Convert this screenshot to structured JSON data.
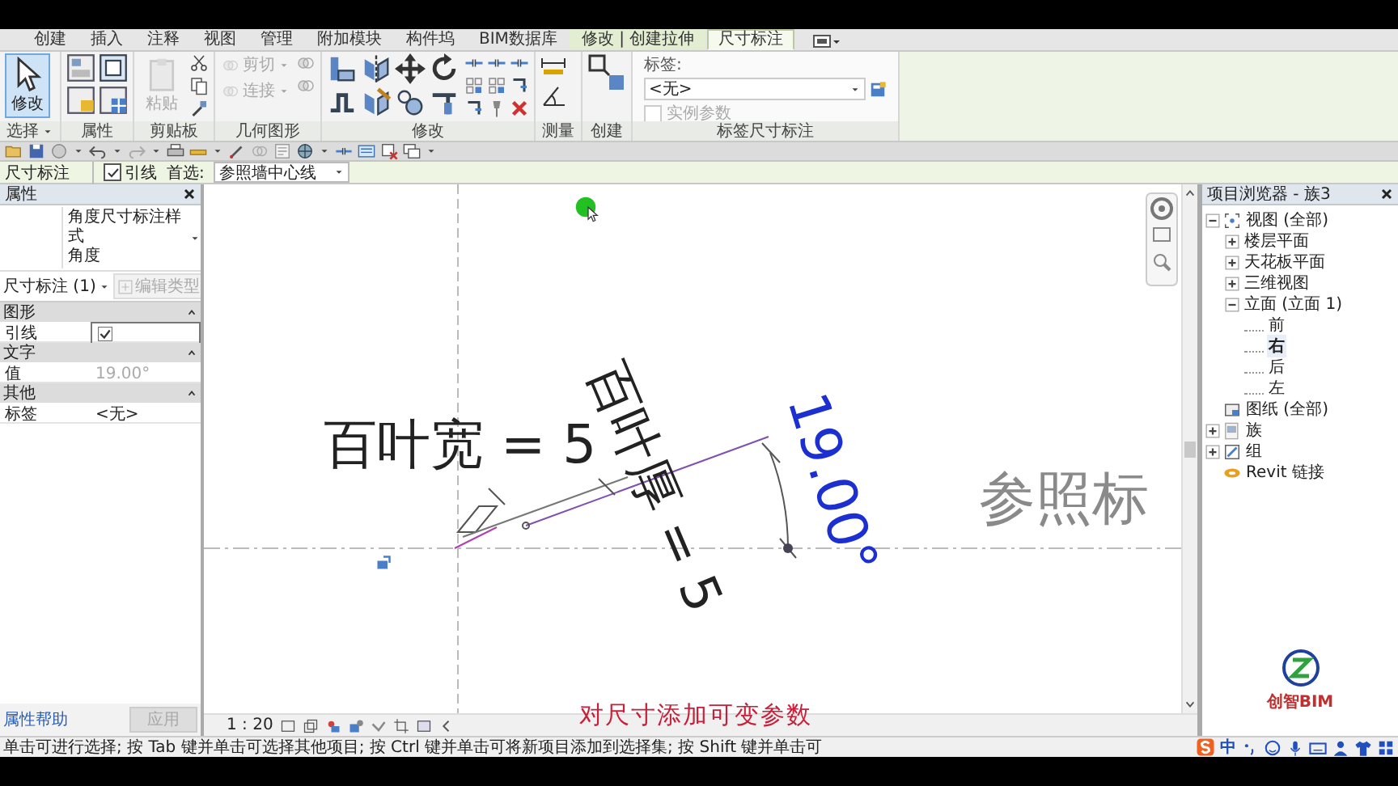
{
  "ribbon_tabs": [
    {
      "label": "创建",
      "kind": "normal",
      "selected": false
    },
    {
      "label": "插入",
      "kind": "normal",
      "selected": false
    },
    {
      "label": "注释",
      "kind": "normal",
      "selected": false
    },
    {
      "label": "视图",
      "kind": "normal",
      "selected": false
    },
    {
      "label": "管理",
      "kind": "normal",
      "selected": false
    },
    {
      "label": "附加模块",
      "kind": "normal",
      "selected": false
    },
    {
      "label": "构件坞",
      "kind": "normal",
      "selected": false
    },
    {
      "label": "BIM数据库",
      "kind": "normal",
      "selected": false
    },
    {
      "label": "修改 | 创建拉伸",
      "kind": "context",
      "selected": false
    },
    {
      "label": "尺寸标注",
      "kind": "context",
      "selected": true
    }
  ],
  "ribbon_panels": [
    {
      "title": "选择",
      "dropdown": true,
      "tools": [
        {
          "label": "修改",
          "kind": "big",
          "selected": true,
          "disabled": false
        }
      ]
    },
    {
      "title": "属性"
    },
    {
      "title": "剪贴板",
      "tools": [
        {
          "label": "粘贴",
          "kind": "big",
          "selected": false,
          "disabled": true
        }
      ]
    },
    {
      "title": "几何图形",
      "tools": [
        {
          "label": "剪切",
          "kind": "small",
          "selected": false,
          "disabled": true
        },
        {
          "label": "连接",
          "kind": "small",
          "selected": false,
          "disabled": true
        }
      ]
    },
    {
      "title": "修改"
    },
    {
      "title": "测量"
    },
    {
      "title": "创建"
    },
    {
      "title": "标签尺寸标注",
      "field": {
        "label": "标签:",
        "value": "<无>"
      },
      "option": {
        "label": "实例参数",
        "checked": false,
        "disabled": true
      }
    }
  ],
  "options_bar": {
    "context": "尺寸标注",
    "leader": {
      "label": "引线",
      "checked": true
    },
    "prefer": {
      "label": "首选:",
      "value": "参照墙中心线"
    }
  },
  "properties": {
    "title": "属性",
    "type_name": "角度尺寸标注样式",
    "type_sub": "角度",
    "instance": "尺寸标注 (1)",
    "edit_type": {
      "label": "编辑类型",
      "disabled": true
    },
    "groups": [
      {
        "name": "图形",
        "rows": [
          {
            "name": "引线",
            "kind": "checkbox",
            "checked": true
          }
        ]
      },
      {
        "name": "文字",
        "rows": [
          {
            "name": "值",
            "kind": "text",
            "value": "19.00°",
            "disabled": true
          }
        ]
      },
      {
        "name": "其他",
        "rows": [
          {
            "name": "标签",
            "kind": "text",
            "value": "<无>",
            "disabled": false
          }
        ]
      }
    ],
    "help": "属性帮助",
    "apply": {
      "label": "应用",
      "disabled": true
    }
  },
  "canvas": {
    "width_param": "百叶宽 = 5",
    "thickness_param": "百叶厚 = 5",
    "angle_dimension": {
      "text": "19.00°",
      "selected": true
    },
    "level_name": "参照标",
    "caption": "对尺寸添加可变参数",
    "scale": "1 : 20"
  },
  "project_browser": {
    "title": "项目浏览器 - 族3",
    "tree": [
      {
        "label": "视图 (全部)",
        "expanded": true,
        "selected": false,
        "children": [
          {
            "label": "楼层平面",
            "expanded": false,
            "selected": false
          },
          {
            "label": "天花板平面",
            "expanded": false,
            "selected": false
          },
          {
            "label": "三维视图",
            "expanded": false,
            "selected": false
          },
          {
            "label": "立面 (立面 1)",
            "expanded": true,
            "selected": false,
            "children": [
              {
                "label": "前",
                "selected": false
              },
              {
                "label": "右",
                "selected": true
              },
              {
                "label": "后",
                "selected": false
              },
              {
                "label": "左",
                "selected": false
              }
            ]
          }
        ]
      },
      {
        "label": "图纸 (全部)",
        "selected": false
      },
      {
        "label": "族",
        "expanded": false,
        "selected": false
      },
      {
        "label": "组",
        "expanded": false,
        "selected": false
      },
      {
        "label": "Revit 链接",
        "selected": false
      }
    ],
    "logo_text": "创智BIM"
  },
  "status_bar": {
    "message": "单击可进行选择; 按 Tab 键并单击可选择其他项目; 按 Ctrl 键并单击可将新项目添加到选择集; 按 Shift 键并单击可",
    "input_mode": "中"
  }
}
